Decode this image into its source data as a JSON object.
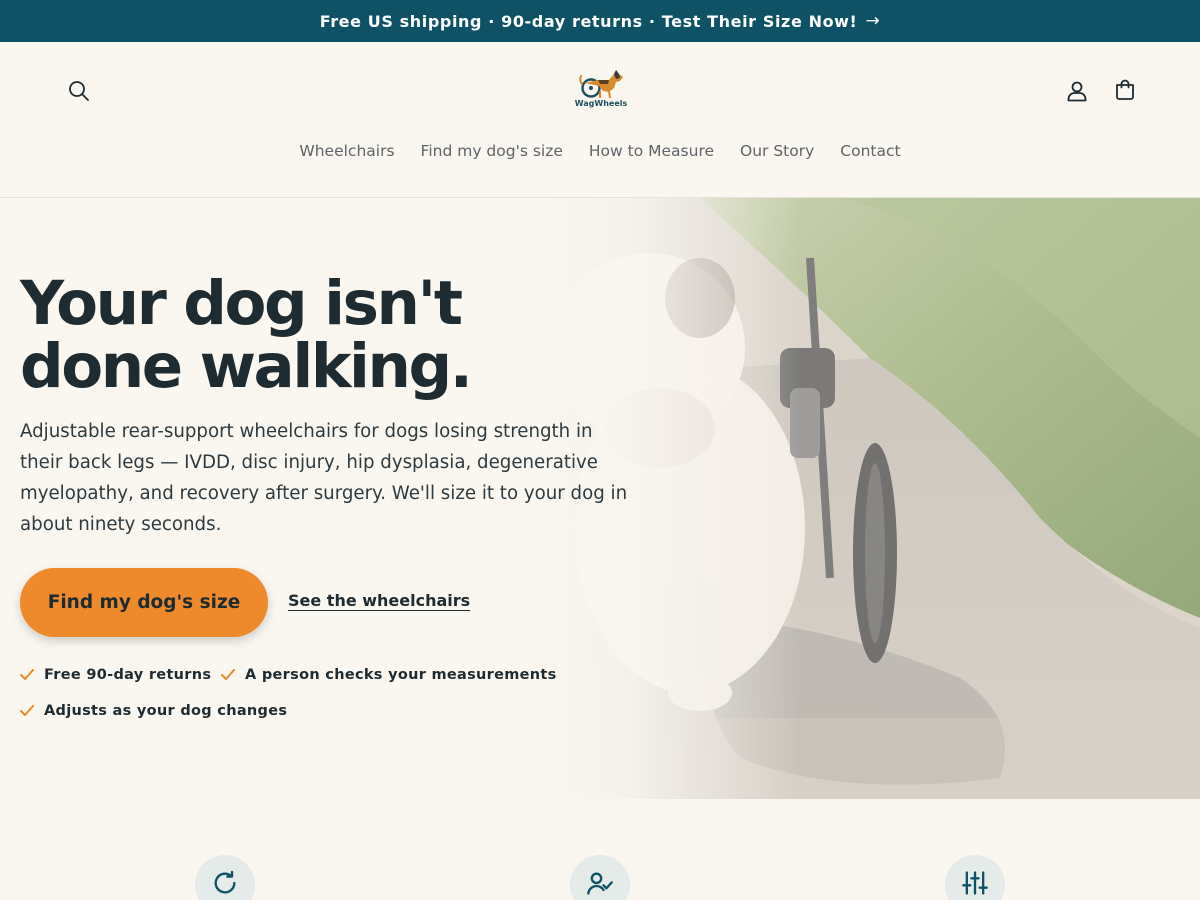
{
  "announcement": {
    "text": "Free US shipping · 90-day returns · Test Their Size Now!",
    "arrow": "→"
  },
  "header": {
    "logo_text": "WagWheels",
    "icons": [
      "search-icon",
      "account-icon",
      "cart-icon"
    ],
    "nav": [
      {
        "label": "Wheelchairs"
      },
      {
        "label": "Find my dog's size"
      },
      {
        "label": "How to Measure"
      },
      {
        "label": "Our Story"
      },
      {
        "label": "Contact"
      }
    ]
  },
  "hero": {
    "headline": "Your dog isn't done walking.",
    "subheadline": "Adjustable rear-support wheelchairs for dogs losing strength in their back legs — IVDD, disc injury, hip dysplasia, degenerative myelopathy, and recovery after surgery. We'll size it to your dog in about ninety seconds.",
    "primary_cta": "Find my dog's size",
    "secondary_cta": "See the wheelchairs",
    "checks": [
      {
        "label": "Free 90-day returns"
      },
      {
        "label": "A person checks your measurements"
      },
      {
        "label": "Adjusts as your dog changes"
      }
    ]
  },
  "features": {
    "icons": [
      "refresh-icon",
      "user-check-icon",
      "sliders-icon"
    ]
  },
  "colors": {
    "announcement_bg": "#0f5265",
    "page_bg": "#faf7f1",
    "accent_orange": "#ee8a2c",
    "text_dark": "#1e2b30",
    "check_orange": "#e8892b",
    "feature_circle": "#e4ebe9"
  }
}
